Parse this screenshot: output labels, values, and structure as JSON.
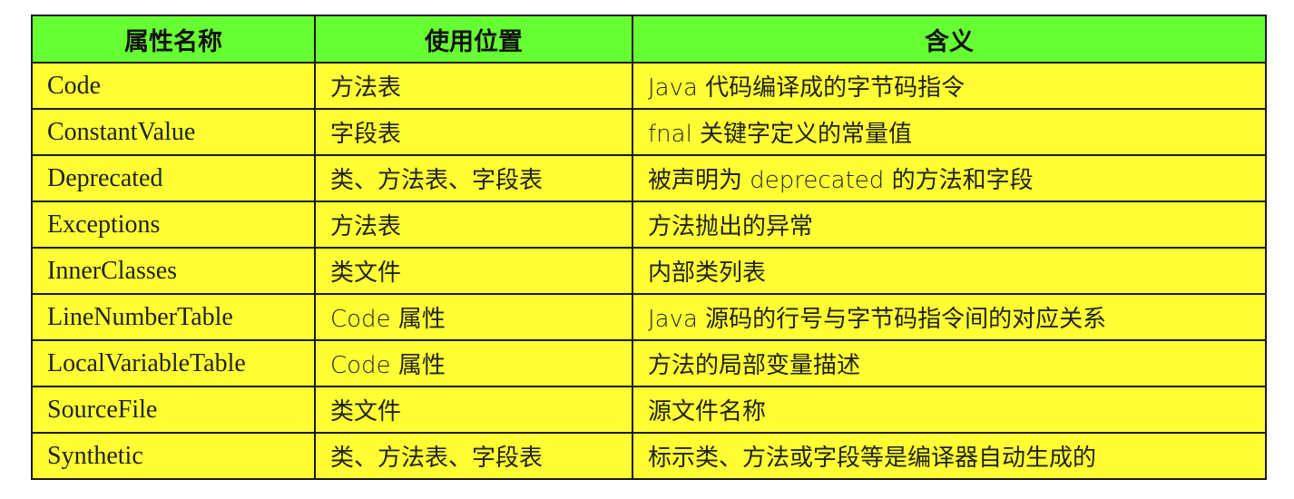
{
  "table": {
    "headers": [
      "属性名称",
      "使用位置",
      "含义"
    ],
    "rows": [
      {
        "name": "Code",
        "location": "方法表",
        "meaning": "Java 代码编译成的字节码指令"
      },
      {
        "name": "ConstantValue",
        "location": "字段表",
        "meaning": "fnal 关键字定义的常量值"
      },
      {
        "name": "Deprecated",
        "location": "类、方法表、字段表",
        "meaning": "被声明为 deprecated 的方法和字段"
      },
      {
        "name": "Exceptions",
        "location": "方法表",
        "meaning": "方法抛出的异常"
      },
      {
        "name": "InnerClasses",
        "location": "类文件",
        "meaning": "内部类列表"
      },
      {
        "name": "LineNumberTable",
        "location": "Code 属性",
        "meaning": "Java 源码的行号与字节码指令间的对应关系"
      },
      {
        "name": "LocalVariableTable",
        "location": "Code 属性",
        "meaning": "方法的局部变量描述"
      },
      {
        "name": "SourceFile",
        "location": "类文件",
        "meaning": "源文件名称"
      },
      {
        "name": "Synthetic",
        "location": "类、方法表、字段表",
        "meaning": "标示类、方法或字段等是编译器自动生成的"
      }
    ]
  },
  "colors": {
    "header_bg": "#66ff33",
    "cell_bg": "#ffff33",
    "border": "#1a1a1a"
  }
}
